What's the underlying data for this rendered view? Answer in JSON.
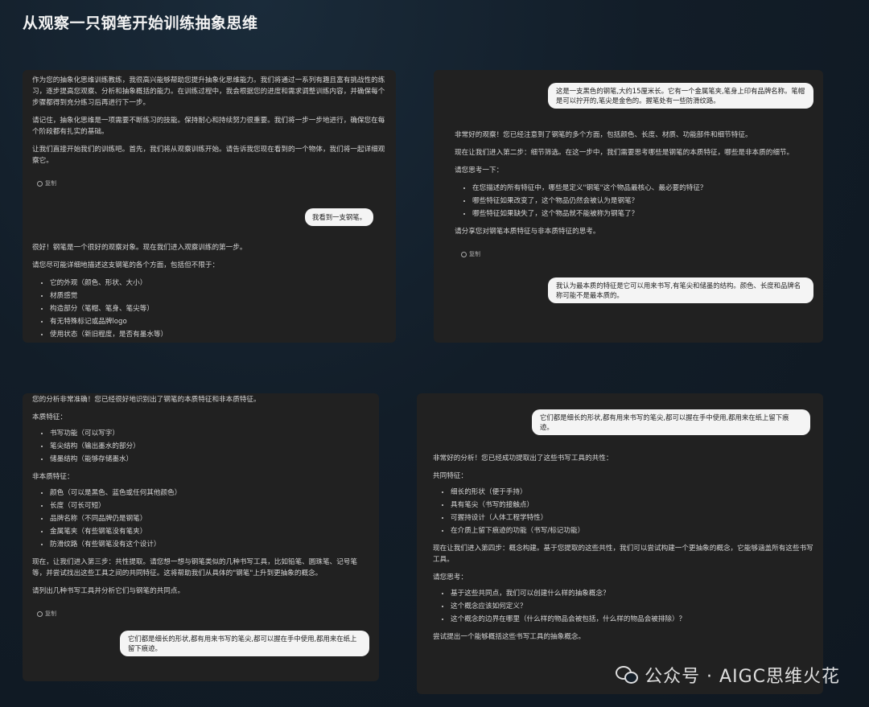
{
  "page_title": "从观察一只钢笔开始训练抽象思维",
  "copy_label": "复制",
  "panel1": {
    "p1": "作为您的抽象化思维训练教练，我很高兴能够帮助您提升抽象化思维能力。我们将通过一系列有趣且富有挑战性的练习，逐步提高您观察、分析和抽象概括的能力。在训练过程中，我会根据您的进度和需求调整训练内容，并确保每个步骤都得到充分练习后再进行下一步。",
    "p2": "请记住，抽象化思维是一项需要不断练习的技能。保持耐心和持续努力很重要。我们将一步一步地进行，确保您在每个阶段都有扎实的基础。",
    "p3": "让我们直接开始我们的训练吧。首先，我们将从观察训练开始。请告诉我您现在看到的一个物体，我们将一起详细观察它。",
    "user_msg": "我看到一支钢笔。",
    "p4": "很好！钢笔是一个很好的观察对象。现在我们进入观察训练的第一步。",
    "p5": "请您尽可能详细地描述这支钢笔的各个方面，包括但不限于：",
    "items": [
      "它的外观（颜色、形状、大小）",
      "材质感觉",
      "构造部分（笔帽、笔身、笔尖等）",
      "有无特殊标记或品牌logo",
      "使用状态（新旧程度，是否有墨水等）"
    ]
  },
  "panel2": {
    "user_msg": "这是一支黑色的钢笔,大约15厘米长。它有一个金属笔夹,笔身上印有品牌名称。笔帽是可以拧开的,笔尖是金色的。握笔处有一些防滑纹路。",
    "p1": "非常好的观察！您已经注意到了钢笔的多个方面，包括颜色、长度、材质、功能部件和细节特征。",
    "p2": "现在让我们进入第二步：细节筛选。在这一步中，我们需要思考哪些是钢笔的本质特征，哪些是非本质的细节。",
    "p3": "请您思考一下：",
    "items": [
      "在您描述的所有特征中，哪些是定义\"钢笔\"这个物品最核心、最必要的特征？",
      "哪些特征如果改变了，这个物品仍然会被认为是钢笔？",
      "哪些特征如果缺失了，这个物品就不能被称为钢笔了？"
    ],
    "p4": "请分享您对钢笔本质特征与非本质特征的思考。",
    "user_msg2": "我认为最本质的特征是它可以用来书写,有笔尖和储墨的结构。颜色、长度和品牌名称可能不是最本质的。"
  },
  "panel3": {
    "p0": "您的分析非常准确！您已经很好地识别出了钢笔的本质特征和非本质特征。",
    "label1": "本质特征：",
    "items1": [
      "书写功能（可以写字）",
      "笔尖结构（输出墨水的部分）",
      "储墨结构（能够存储墨水）"
    ],
    "label2": "非本质特征：",
    "items2": [
      "颜色（可以是黑色、蓝色或任何其他颜色）",
      "长度（可长可短）",
      "品牌名称（不同品牌仍是钢笔）",
      "金属笔夹（有些钢笔没有笔夹）",
      "防滑纹路（有些钢笔没有这个设计）"
    ],
    "p1": "现在，让我们进入第三步：共性提取。请您想一想与钢笔类似的几种书写工具，比如铅笔、圆珠笔、记号笔等，并尝试找出这些工具之间的共同特征。这将帮助我们从具体的\"钢笔\"上升到更抽象的概念。",
    "p2": "请列出几种书写工具并分析它们与钢笔的共同点。",
    "user_msg": "它们都是细长的形状,都有用来书写的笔尖,都可以握在手中使用,都用来在纸上留下痕迹。"
  },
  "panel4": {
    "user_msg": "它们都是细长的形状,都有用来书写的笔尖,都可以握在手中使用,都用来在纸上留下痕迹。",
    "p1": "非常好的分析！您已经成功提取出了这些书写工具的共性：",
    "label1": "共同特征：",
    "items1": [
      "细长的形状（便于手持）",
      "具有笔尖（书写的接触点）",
      "可握持设计（人体工程学特性）",
      "在介质上留下痕迹的功能（书写/标记功能）"
    ],
    "p2": "现在让我们进入第四步：概念构建。基于您提取的这些共性，我们可以尝试构建一个更抽象的概念，它能够涵盖所有这些书写工具。",
    "label2": "请您思考：",
    "items2": [
      "基于这些共同点，我们可以创建什么样的抽象概念？",
      "这个概念应该如何定义？",
      "这个概念的边界在哪里（什么样的物品会被包括，什么样的物品会被排除）？"
    ],
    "p3": "尝试提出一个能够概括这些书写工具的抽象概念。"
  },
  "watermark": "公众号 · AIGC思维火花"
}
